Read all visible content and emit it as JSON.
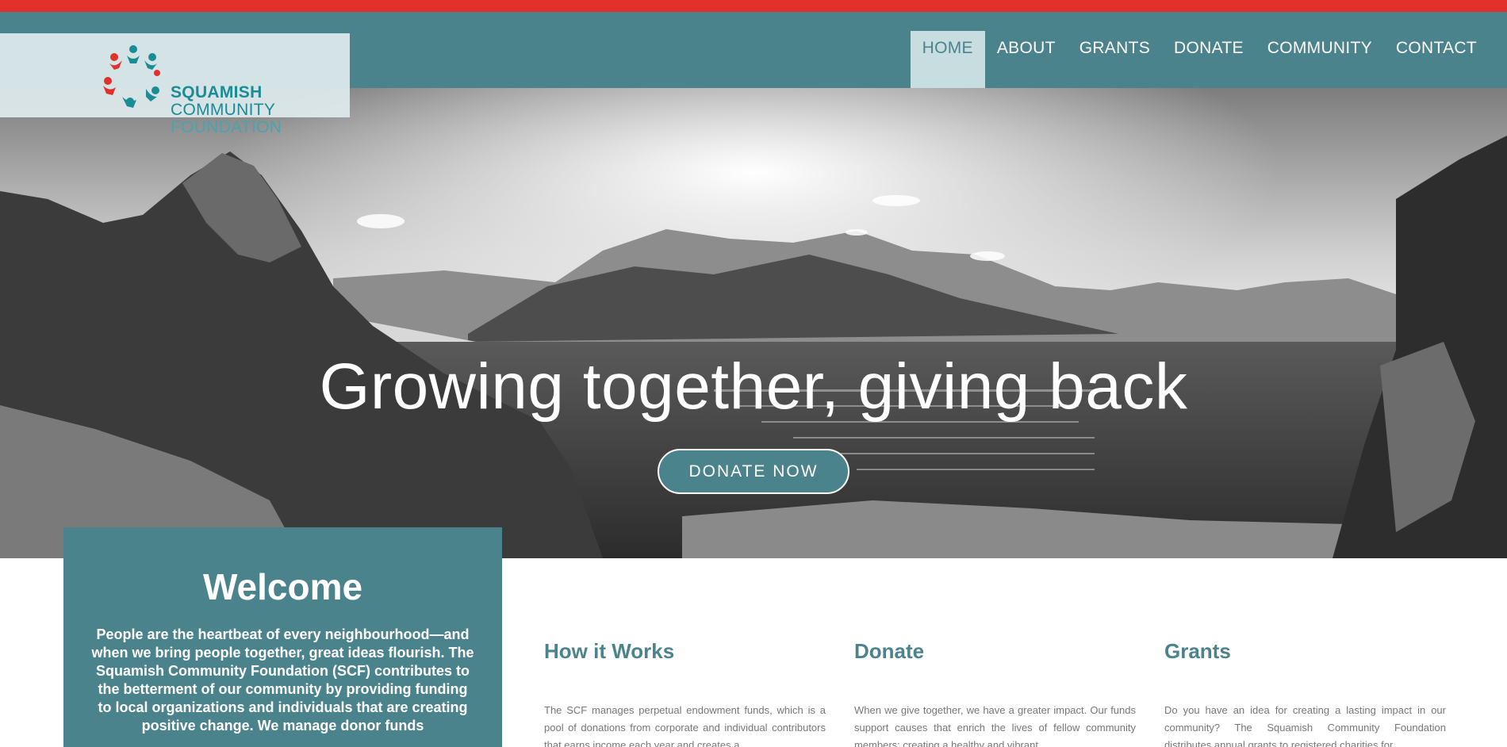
{
  "colors": {
    "accent_red": "#e2302a",
    "brand_teal": "#4b838c",
    "nav_active_bg": "#c7dde0"
  },
  "logo": {
    "line1": "SQUAMISH",
    "line2": "COMMUNITY",
    "line3": "FOUNDATION",
    "icon": "people-circle-logo"
  },
  "nav": {
    "items": [
      {
        "label": "HOME",
        "active": true
      },
      {
        "label": "ABOUT"
      },
      {
        "label": "GRANTS"
      },
      {
        "label": "DONATE"
      },
      {
        "label": "COMMUNITY"
      },
      {
        "label": "CONTACT"
      }
    ]
  },
  "hero": {
    "title": "Growing together, giving back",
    "button": "DONATE NOW",
    "image": "mountain-valley-photo"
  },
  "welcome": {
    "title": "Welcome",
    "text": "People are the heartbeat of every neighbourhood—and when we bring people together, great ideas flourish. The Squamish Community Foundation (SCF) contributes to the betterment of our community by providing funding to local organizations and individuals that are creating positive change. We manage donor funds"
  },
  "columns": [
    {
      "title": "How it Works",
      "text": "The SCF manages perpetual endowment funds, which is a pool of donations from corporate and individual contributors that earns income each year and creates a"
    },
    {
      "title": "Donate",
      "text": "When we give together, we have a greater impact. Our funds support causes that enrich the lives of fellow community members; creating a healthy and vibrant"
    },
    {
      "title": "Grants",
      "text": "Do you have an idea for creating a lasting impact in our community? The Squamish Community Foundation distributes annual grants to registered charities for"
    }
  ]
}
